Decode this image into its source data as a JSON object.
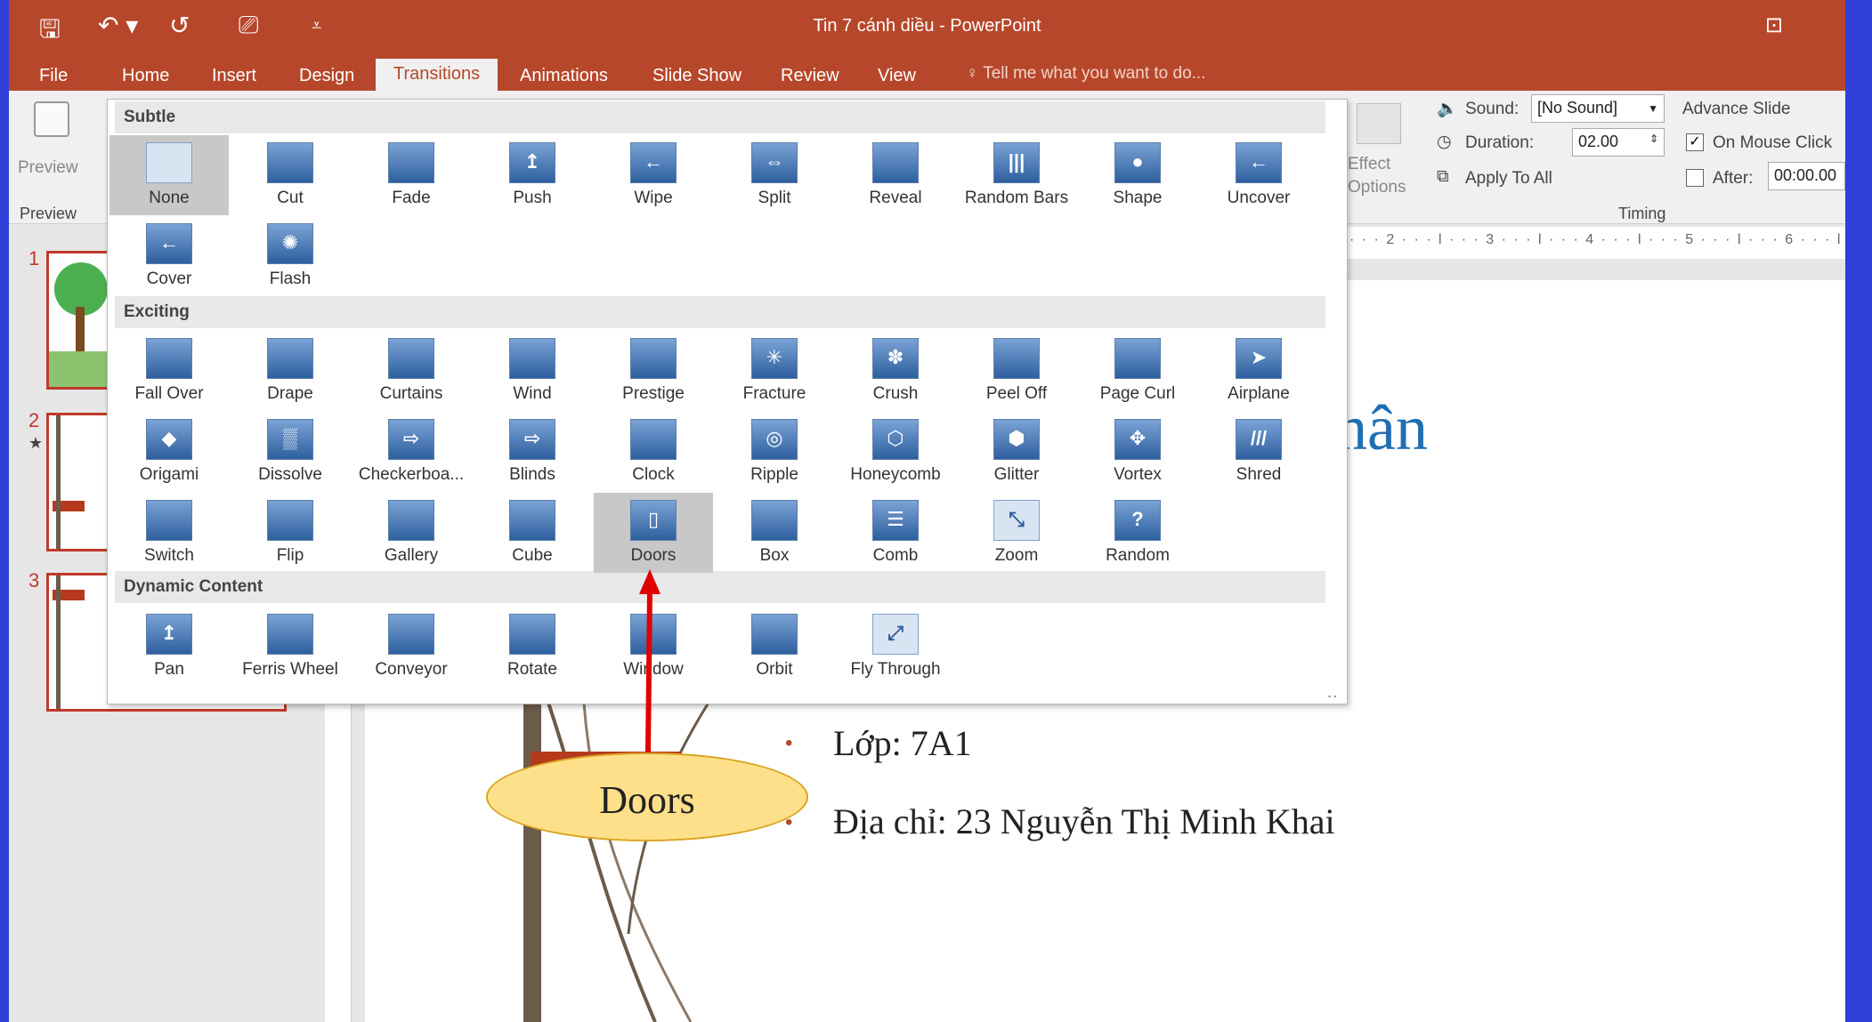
{
  "window": {
    "title": "Tin 7 cánh diều - PowerPoint"
  },
  "qat": {
    "save_icon": "save-icon",
    "undo_icon": "undo-icon",
    "redo_icon": "redo-icon",
    "present_icon": "present-icon",
    "more_icon": "customize-icon"
  },
  "tabs": [
    "File",
    "Home",
    "Insert",
    "Design",
    "Transitions",
    "Animations",
    "Slide Show",
    "Review",
    "View"
  ],
  "active_tab": "Transitions",
  "tell_me": "Tell me what you want to do...",
  "ribbon": {
    "preview_label": "Preview",
    "preview_group": "Preview",
    "effect_options": "Effect\nOptions",
    "sound_label": "Sound:",
    "sound_value": "[No Sound]",
    "duration_label": "Duration:",
    "duration_value": "02.00",
    "apply_all": "Apply To All",
    "advance_slide": "Advance Slide",
    "on_mouse_click": "On Mouse Click",
    "on_mouse_click_checked": true,
    "after_label": "After:",
    "after_value": "00:00.00",
    "after_checked": false,
    "timing_group": "Timing"
  },
  "ruler_text": "· · · 2 · · · l · · · 3 · · · l · · · 4 · · · l · · · 5 · · · l · · · 6 · · · l ·",
  "slides": [
    "1",
    "2",
    "3"
  ],
  "slide_content": {
    "heading_fragment": "hân",
    "bullets": [
      "Lớp: 7A1",
      "Địa chỉ: 23 Nguyễn Thị Minh Khai"
    ]
  },
  "gallery": {
    "sections": [
      {
        "name": "Subtle",
        "items": [
          "None",
          "Cut",
          "Fade",
          "Push",
          "Wipe",
          "Split",
          "Reveal",
          "Random Bars",
          "Shape",
          "Uncover",
          "Cover",
          "Flash"
        ]
      },
      {
        "name": "Exciting",
        "items": [
          "Fall Over",
          "Drape",
          "Curtains",
          "Wind",
          "Prestige",
          "Fracture",
          "Crush",
          "Peel Off",
          "Page Curl",
          "Airplane",
          "Origami",
          "Dissolve",
          "Checkerboa...",
          "Blinds",
          "Clock",
          "Ripple",
          "Honeycomb",
          "Glitter",
          "Vortex",
          "Shred",
          "Switch",
          "Flip",
          "Gallery",
          "Cube",
          "Doors",
          "Box",
          "Comb",
          "Zoom",
          "Random"
        ]
      },
      {
        "name": "Dynamic Content",
        "items": [
          "Pan",
          "Ferris Wheel",
          "Conveyor",
          "Rotate",
          "Window",
          "Orbit",
          "Fly Through"
        ]
      }
    ],
    "selected": [
      "None",
      "Doors"
    ]
  },
  "callout": {
    "text": "Doors",
    "color": "#ffe08a",
    "arrow_color": "#e00000"
  },
  "colors": {
    "accent": "#b7472a",
    "heading": "#1f6fb2"
  }
}
